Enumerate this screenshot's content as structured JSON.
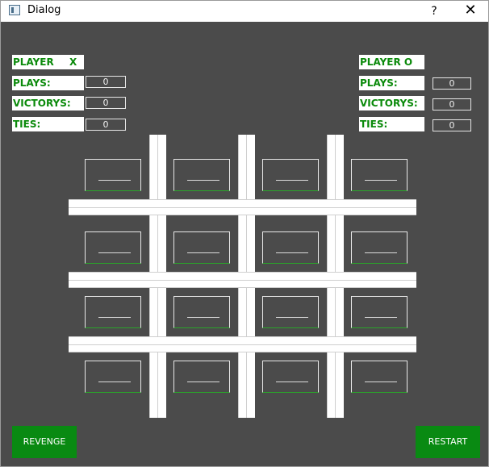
{
  "window": {
    "title": "Dialog",
    "help": "?",
    "close": "✕"
  },
  "player_x": {
    "label": "PLAYER",
    "mark": "X",
    "plays_label": "PLAYS:",
    "plays": "0",
    "victorys_label": "VICTORYS:",
    "victorys": "0",
    "ties_label": "TIES:",
    "ties": "0"
  },
  "player_o": {
    "label": "PLAYER O",
    "plays_label": "PLAYS:",
    "plays": "0",
    "victorys_label": "VICTORYS:",
    "victorys": "0",
    "ties_label": "TIES:",
    "ties": "0"
  },
  "board": {
    "rows": 4,
    "cols": 4,
    "cells": [
      "",
      "",
      "",
      "",
      "",
      "",
      "",
      "",
      "",
      "",
      "",
      "",
      "",
      "",
      "",
      ""
    ]
  },
  "buttons": {
    "revenge": "REVENGE",
    "restart": "RESTART"
  },
  "colors": {
    "accent_green": "#098a12",
    "label_green": "#0b8a0b",
    "background": "#4b4b4b"
  }
}
